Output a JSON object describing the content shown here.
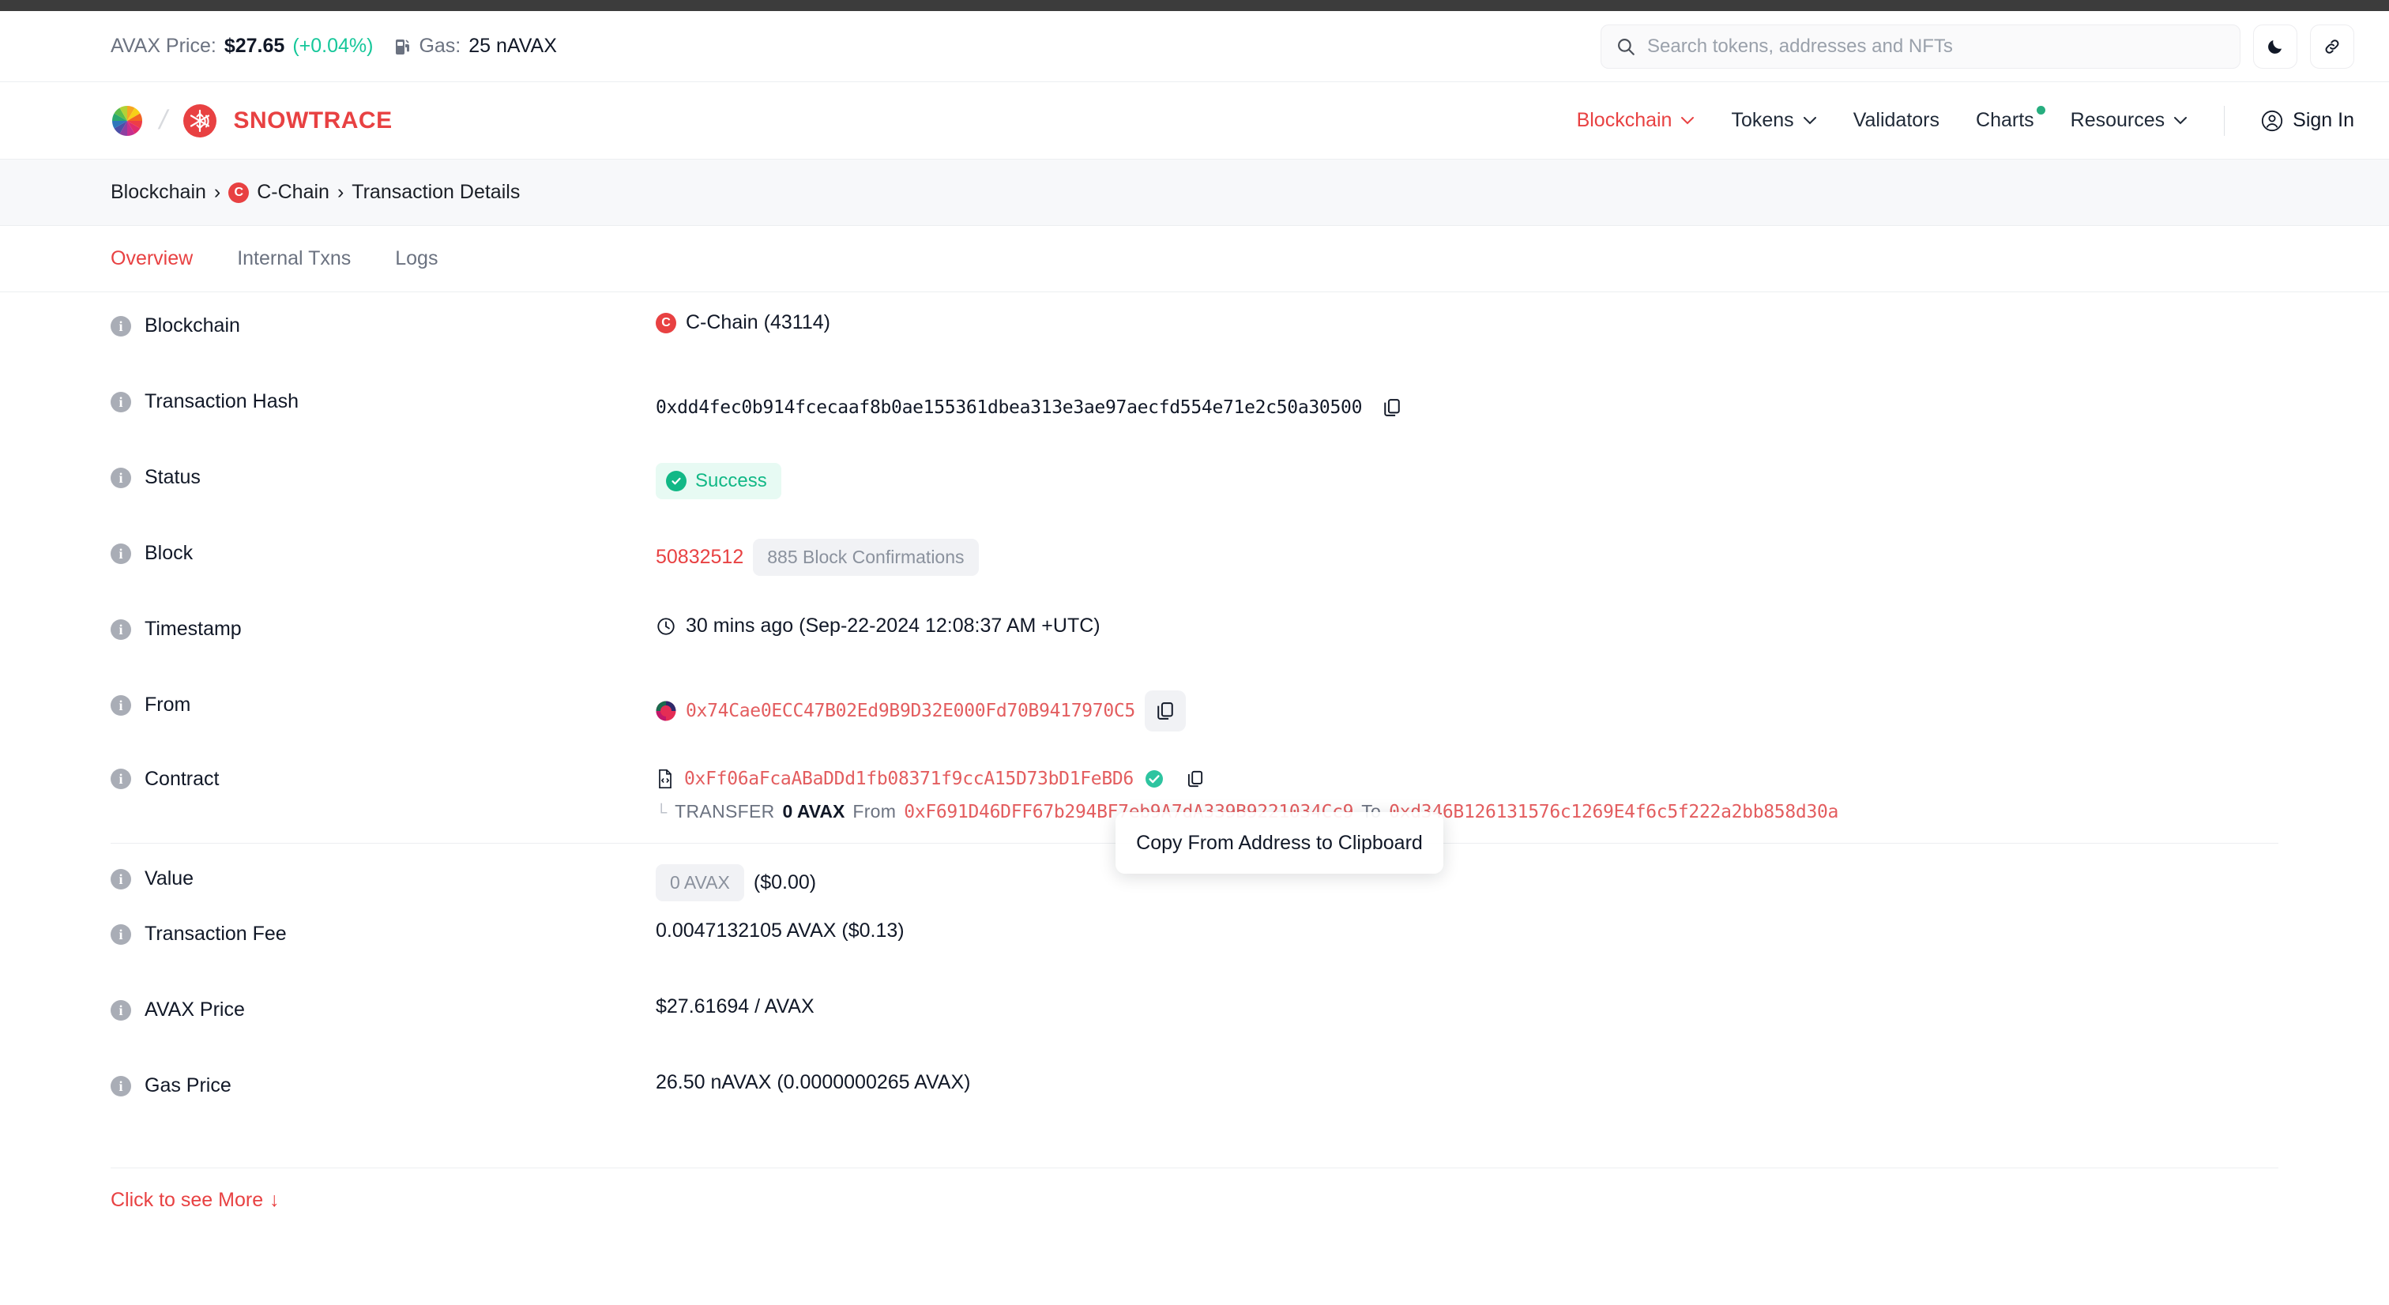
{
  "ticker": {
    "price_label": "AVAX Price:",
    "price_value": "$27.65",
    "price_change": "(+0.04%)",
    "gas_label": "Gas:",
    "gas_value": "25 nAVAX",
    "gas_icon": "fuel-pump-icon"
  },
  "search": {
    "placeholder": "Search tokens, addresses and NFTs",
    "icon": "search-icon"
  },
  "topbuttons": {
    "theme_icon": "moon-icon",
    "link_icon": "link-icon"
  },
  "brand": {
    "wheel_icon": "avalanche-wheel-icon",
    "separator": "/",
    "snowflake_icon": "snowflake-icon",
    "name": "SNOWTRACE"
  },
  "nav": {
    "items": [
      {
        "label": "Blockchain",
        "chevron": true,
        "active": true,
        "dot": false
      },
      {
        "label": "Tokens",
        "chevron": true,
        "active": false,
        "dot": false
      },
      {
        "label": "Validators",
        "chevron": false,
        "active": false,
        "dot": false
      },
      {
        "label": "Charts",
        "chevron": false,
        "active": false,
        "dot": true
      },
      {
        "label": "Resources",
        "chevron": true,
        "active": false,
        "dot": false
      }
    ],
    "signin": "Sign In",
    "signin_icon": "user-circle-icon"
  },
  "breadcrumb": {
    "item1": "Blockchain",
    "sep1": "›",
    "chain_badge": "C",
    "item2": "C-Chain",
    "sep2": "›",
    "item3": "Transaction Details"
  },
  "tabs": [
    {
      "label": "Overview",
      "active": true
    },
    {
      "label": "Internal Txns",
      "active": false
    },
    {
      "label": "Logs",
      "active": false
    }
  ],
  "rows": {
    "blockchain": {
      "label": "Blockchain",
      "badge": "C",
      "value": "C-Chain (43114)"
    },
    "txhash": {
      "label": "Transaction Hash",
      "value": "0xdd4fec0b914fcecaaf8b0ae155361dbea313e3ae97aecfd554e71e2c50a30500",
      "copy_icon": "copy-icon"
    },
    "status": {
      "label": "Status",
      "value": "Success",
      "check_icon": "check-circle-icon"
    },
    "block": {
      "label": "Block",
      "number": "50832512",
      "confirmations": "885 Block Confirmations"
    },
    "timestamp": {
      "label": "Timestamp",
      "clock_icon": "clock-icon",
      "value": "30 mins ago (Sep-22-2024 12:08:37 AM +UTC)"
    },
    "from": {
      "label": "From",
      "avatar_icon": "address-avatar-icon",
      "address": "0x74Cae0ECC47B02Ed9B9D32E000Fd70B9417970C5",
      "copy_icon": "copy-icon"
    },
    "contract": {
      "label": "Contract",
      "doc_icon": "contract-file-icon",
      "address": "0xFf06aFcaABaDDd1fb08371f9ccA15D73bD1FeBD6",
      "verified_icon": "verified-check-icon",
      "copy_icon": "copy-icon",
      "transfer": {
        "corner": "└",
        "label": "TRANSFER",
        "amount": "0 AVAX",
        "from_label": "From",
        "from_address": "0xF691D46DFF67b294BF7eb9A7dA339B9221034Cc9",
        "to_label": "To",
        "to_address": "0xd346B126131576c1269E4f6c5f222a2bb858d30a"
      }
    },
    "value": {
      "label": "Value",
      "badge": "0 AVAX",
      "usd": "($0.00)"
    },
    "txfee": {
      "label": "Transaction Fee",
      "value": "0.0047132105 AVAX ($0.13)"
    },
    "avaxprice": {
      "label": "AVAX Price",
      "value": "$27.61694 / AVAX"
    },
    "gasprice": {
      "label": "Gas Price",
      "value": "26.50 nAVAX (0.0000000265 AVAX)"
    }
  },
  "see_more": {
    "label": "Click to see More",
    "chevron": "↓"
  },
  "tooltip": {
    "text": "Copy From Address to Clipboard"
  },
  "colors": {
    "brand_red": "#e84142",
    "success_green": "#12b886",
    "ticker_green": "#16c79a",
    "muted": "#6b7280"
  }
}
